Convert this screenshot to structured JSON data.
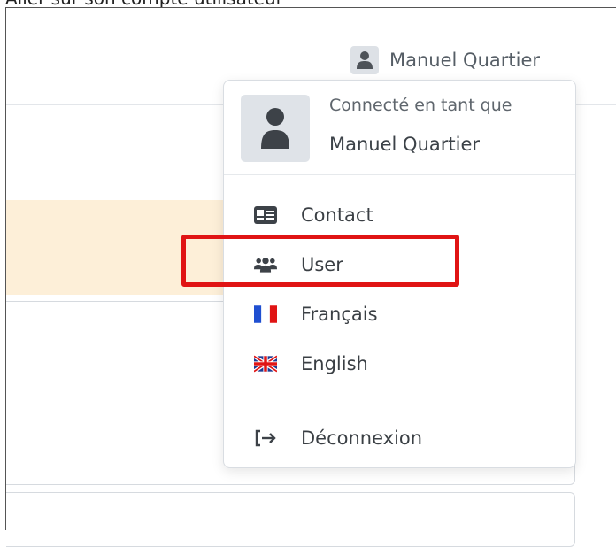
{
  "caption": "Aller sur son compte utilisateur",
  "header": {
    "user_name": "Manuel Quartier",
    "avatar_icon": "user-icon"
  },
  "dropdown": {
    "connected_as": "Connecté en tant que",
    "user_name": "Manuel Quartier",
    "items": [
      {
        "label": "Contact",
        "icon": "id-card-icon"
      },
      {
        "label": "User",
        "icon": "users-icon"
      },
      {
        "label": "Français",
        "icon": "flag-france-icon"
      },
      {
        "label": "English",
        "icon": "flag-uk-icon"
      },
      {
        "label": "Déconnexion",
        "icon": "sign-out-icon"
      }
    ]
  },
  "colors": {
    "highlight": "#e01414",
    "banner": "#fdefd8",
    "flag_blue": "#1f4fd1",
    "flag_red": "#e01414"
  }
}
